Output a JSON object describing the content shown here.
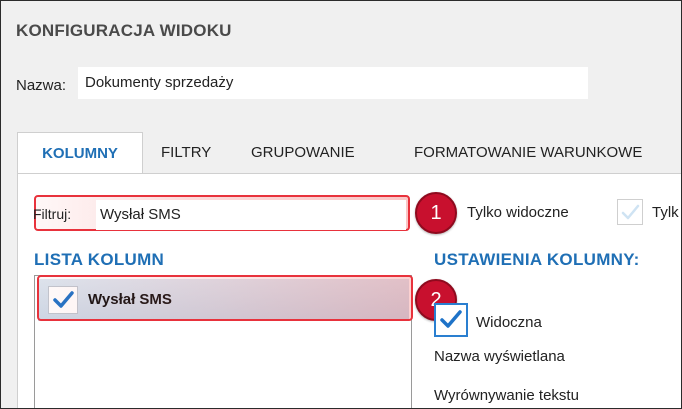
{
  "window": {
    "title": "KONFIGURACJA WIDOKU"
  },
  "name_field": {
    "label": "Nazwa:",
    "value": "Dokumenty sprzedaży"
  },
  "tabs": [
    {
      "label": "KOLUMNY",
      "active": true
    },
    {
      "label": "FILTRY"
    },
    {
      "label": "GRUPOWANIE"
    },
    {
      "label": "FORMATOWANIE WARUNKOWE"
    }
  ],
  "filter": {
    "label": "Filtruj:",
    "value": "Wysłał SMS",
    "only_visible_label": "Tylko widoczne",
    "second_option_label": "Tylk"
  },
  "column_list": {
    "heading": "LISTA KOLUMN",
    "items": [
      {
        "label": "Wysłał SMS",
        "checked": true
      }
    ]
  },
  "column_settings": {
    "heading": "USTAWIENIA KOLUMNY:",
    "visible_label": "Widoczna",
    "display_name_label": "Nazwa wyświetlana",
    "text_align_label": "Wyrównywanie tekstu"
  },
  "markers": [
    "1",
    "2"
  ],
  "colors": {
    "accent": "#1f6fb5",
    "highlight": "#e8323c",
    "marker": "#c8102e",
    "check": "#1e73c8"
  },
  "icons": {
    "check": "check-icon"
  }
}
